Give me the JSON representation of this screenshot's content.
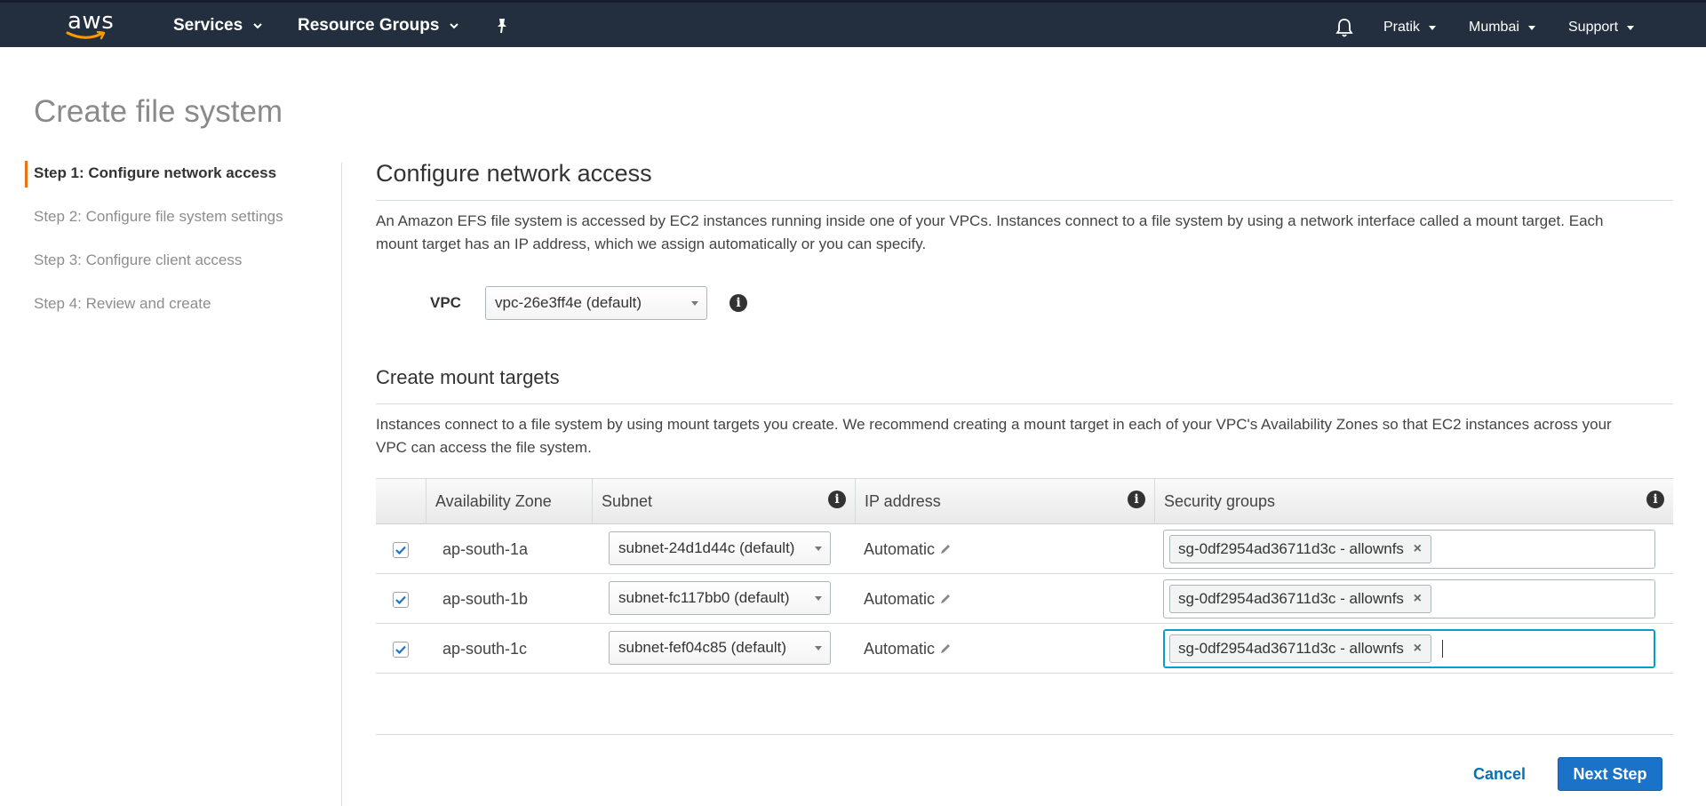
{
  "nav": {
    "logo_text": "aws",
    "services": "Services",
    "resource_groups": "Resource Groups",
    "user": "Pratik",
    "region": "Mumbai",
    "support": "Support"
  },
  "page": {
    "title": "Create file system"
  },
  "steps": [
    {
      "label": "Step 1: Configure network access",
      "active": true
    },
    {
      "label": "Step 2: Configure file system settings",
      "active": false
    },
    {
      "label": "Step 3: Configure client access",
      "active": false
    },
    {
      "label": "Step 4: Review and create",
      "active": false
    }
  ],
  "network": {
    "title": "Configure network access",
    "description_line1": "An Amazon EFS file system is accessed by EC2 instances running inside one of your VPCs. Instances connect to a file system by using a network interface called a mount target. Each",
    "description_line2": "mount target has an IP address, which we assign automatically or you can specify.",
    "vpc_label": "VPC",
    "vpc_value": "vpc-26e3ff4e (default)"
  },
  "mount": {
    "title": "Create mount targets",
    "description_line1": "Instances connect to a file system by using mount targets you create. We recommend creating a mount target in each of your VPC's Availability Zones so that EC2 instances across your",
    "description_line2": "VPC can access the file system.",
    "columns": {
      "az": "Availability Zone",
      "subnet": "Subnet",
      "ip": "IP address",
      "sg": "Security groups"
    },
    "rows": [
      {
        "az": "ap-south-1a",
        "subnet": "subnet-24d1d44c (default)",
        "ip": "Automatic",
        "sg": "sg-0df2954ad36711d3c - allownfs",
        "checked": true
      },
      {
        "az": "ap-south-1b",
        "subnet": "subnet-fc117bb0 (default)",
        "ip": "Automatic",
        "sg": "sg-0df2954ad36711d3c - allownfs",
        "checked": true
      },
      {
        "az": "ap-south-1c",
        "subnet": "subnet-fef04c85 (default)",
        "ip": "Automatic",
        "sg": "sg-0df2954ad36711d3c - allownfs",
        "checked": true
      }
    ]
  },
  "actions": {
    "cancel": "Cancel",
    "next": "Next Step"
  },
  "colors": {
    "nav_bg": "#232f3e",
    "active_step_accent": "#ec7211",
    "primary_button": "#1a73c8",
    "link": "#0073bb"
  }
}
